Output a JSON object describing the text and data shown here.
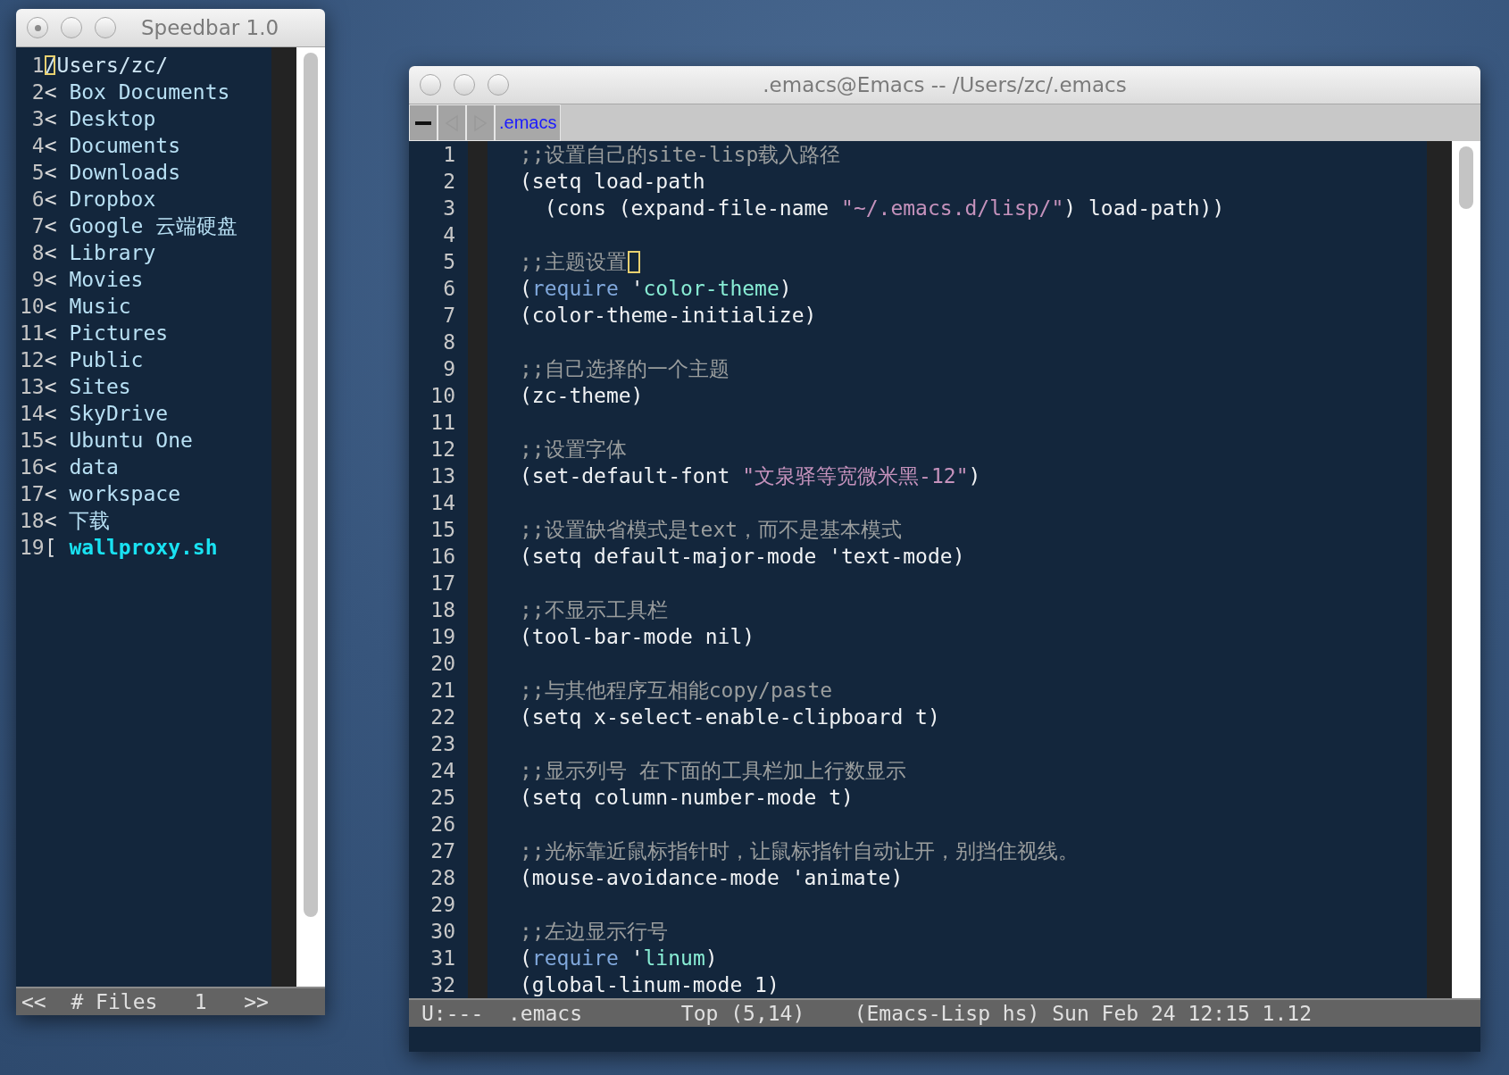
{
  "speedbar": {
    "window": {
      "title": "Speedbar 1.0"
    },
    "items": [
      {
        "number": "1",
        "marker": "",
        "name": "/Users/zc/",
        "kind": "root",
        "cursor": true
      },
      {
        "number": "2",
        "marker": "<",
        "name": "Box Documents",
        "kind": "directory",
        "cursor": false
      },
      {
        "number": "3",
        "marker": "<",
        "name": "Desktop",
        "kind": "directory",
        "cursor": false
      },
      {
        "number": "4",
        "marker": "<",
        "name": "Documents",
        "kind": "directory",
        "cursor": false
      },
      {
        "number": "5",
        "marker": "<",
        "name": "Downloads",
        "kind": "directory",
        "cursor": false
      },
      {
        "number": "6",
        "marker": "<",
        "name": "Dropbox",
        "kind": "directory",
        "cursor": false
      },
      {
        "number": "7",
        "marker": "<",
        "name": "Google 云端硬盘",
        "kind": "directory",
        "cursor": false
      },
      {
        "number": "8",
        "marker": "<",
        "name": "Library",
        "kind": "directory",
        "cursor": false
      },
      {
        "number": "9",
        "marker": "<",
        "name": "Movies",
        "kind": "directory",
        "cursor": false
      },
      {
        "number": "10",
        "marker": "<",
        "name": "Music",
        "kind": "directory",
        "cursor": false
      },
      {
        "number": "11",
        "marker": "<",
        "name": "Pictures",
        "kind": "directory",
        "cursor": false
      },
      {
        "number": "12",
        "marker": "<",
        "name": "Public",
        "kind": "directory",
        "cursor": false
      },
      {
        "number": "13",
        "marker": "<",
        "name": "Sites",
        "kind": "directory",
        "cursor": false
      },
      {
        "number": "14",
        "marker": "<",
        "name": "SkyDrive",
        "kind": "directory",
        "cursor": false
      },
      {
        "number": "15",
        "marker": "<",
        "name": "Ubuntu One",
        "kind": "directory",
        "cursor": false
      },
      {
        "number": "16",
        "marker": "<",
        "name": "data",
        "kind": "directory",
        "cursor": false
      },
      {
        "number": "17",
        "marker": "<",
        "name": "workspace",
        "kind": "directory",
        "cursor": false
      },
      {
        "number": "18",
        "marker": "<",
        "name": "下载",
        "kind": "directory",
        "cursor": false
      },
      {
        "number": "19",
        "marker": "[",
        "name": "wallproxy.sh",
        "kind": "file",
        "cursor": false
      }
    ],
    "mode_line": {
      "prev": "<<",
      "label": "# Files",
      "page": "1",
      "next": ">>"
    }
  },
  "editor": {
    "window": {
      "title": ".emacs@Emacs -- /Users/zc/.emacs"
    },
    "tabs": [
      {
        "label": ".emacs",
        "selected": true
      }
    ],
    "lines": [
      {
        "number": "1",
        "cursor": false,
        "segments": [
          {
            "kind": "comment",
            "text": ";;设置自己的site-lisp载入路径"
          }
        ]
      },
      {
        "number": "2",
        "cursor": false,
        "segments": [
          {
            "kind": "plain",
            "text": "(setq load-path"
          }
        ]
      },
      {
        "number": "3",
        "cursor": false,
        "segments": [
          {
            "kind": "plain",
            "text": "  (cons (expand-file-name "
          },
          {
            "kind": "string",
            "text": "\"~/.emacs.d/lisp/\""
          },
          {
            "kind": "plain",
            "text": ") load-path))"
          }
        ]
      },
      {
        "number": "4",
        "cursor": false
      },
      {
        "number": "5",
        "cursor": true,
        "segments": [
          {
            "kind": "comment",
            "text": ";;主题设置"
          }
        ]
      },
      {
        "number": "6",
        "cursor": false,
        "segments": [
          {
            "kind": "plain",
            "text": "("
          },
          {
            "kind": "keyword",
            "text": "require"
          },
          {
            "kind": "plain",
            "text": " '"
          },
          {
            "kind": "constant",
            "text": "color-theme"
          },
          {
            "kind": "plain",
            "text": ")"
          }
        ]
      },
      {
        "number": "7",
        "cursor": false,
        "segments": [
          {
            "kind": "plain",
            "text": "(color-theme-initialize)"
          }
        ]
      },
      {
        "number": "8",
        "cursor": false
      },
      {
        "number": "9",
        "cursor": false,
        "segments": [
          {
            "kind": "comment",
            "text": ";;自己选择的一个主题"
          }
        ]
      },
      {
        "number": "10",
        "cursor": false,
        "segments": [
          {
            "kind": "plain",
            "text": "(zc-theme)"
          }
        ]
      },
      {
        "number": "11",
        "cursor": false
      },
      {
        "number": "12",
        "cursor": false,
        "segments": [
          {
            "kind": "comment",
            "text": ";;设置字体"
          }
        ]
      },
      {
        "number": "13",
        "cursor": false,
        "segments": [
          {
            "kind": "plain",
            "text": "(set-default-font "
          },
          {
            "kind": "string",
            "text": "\"文泉驿等宽微米黑-12\""
          },
          {
            "kind": "plain",
            "text": ")"
          }
        ]
      },
      {
        "number": "14",
        "cursor": false
      },
      {
        "number": "15",
        "cursor": false,
        "segments": [
          {
            "kind": "comment",
            "text": ";;设置缺省模式是text，而不是基本模式"
          }
        ]
      },
      {
        "number": "16",
        "cursor": false,
        "segments": [
          {
            "kind": "plain",
            "text": "(setq default-major-mode 'text-mode)"
          }
        ]
      },
      {
        "number": "17",
        "cursor": false
      },
      {
        "number": "18",
        "cursor": false,
        "segments": [
          {
            "kind": "comment",
            "text": ";;不显示工具栏"
          }
        ]
      },
      {
        "number": "19",
        "cursor": false,
        "segments": [
          {
            "kind": "plain",
            "text": "(tool-bar-mode nil)"
          }
        ]
      },
      {
        "number": "20",
        "cursor": false
      },
      {
        "number": "21",
        "cursor": false,
        "segments": [
          {
            "kind": "comment",
            "text": ";;与其他程序互相能copy/paste"
          }
        ]
      },
      {
        "number": "22",
        "cursor": false,
        "segments": [
          {
            "kind": "plain",
            "text": "(setq x-select-enable-clipboard t)"
          }
        ]
      },
      {
        "number": "23",
        "cursor": false
      },
      {
        "number": "24",
        "cursor": false,
        "segments": [
          {
            "kind": "comment",
            "text": ";;显示列号 在下面的工具栏加上行数显示"
          }
        ]
      },
      {
        "number": "25",
        "cursor": false,
        "segments": [
          {
            "kind": "plain",
            "text": "(setq column-number-mode t)"
          }
        ]
      },
      {
        "number": "26",
        "cursor": false
      },
      {
        "number": "27",
        "cursor": false,
        "segments": [
          {
            "kind": "comment",
            "text": ";;光标靠近鼠标指针时，让鼠标指针自动让开，别挡住视线。"
          }
        ]
      },
      {
        "number": "28",
        "cursor": false,
        "segments": [
          {
            "kind": "plain",
            "text": "(mouse-avoidance-mode 'animate)"
          }
        ]
      },
      {
        "number": "29",
        "cursor": false
      },
      {
        "number": "30",
        "cursor": false,
        "segments": [
          {
            "kind": "comment",
            "text": ";;左边显示行号"
          }
        ]
      },
      {
        "number": "31",
        "cursor": false,
        "segments": [
          {
            "kind": "plain",
            "text": "("
          },
          {
            "kind": "keyword",
            "text": "require"
          },
          {
            "kind": "plain",
            "text": " '"
          },
          {
            "kind": "constant",
            "text": "linum"
          },
          {
            "kind": "plain",
            "text": ")"
          }
        ]
      },
      {
        "number": "32",
        "cursor": false,
        "segments": [
          {
            "kind": "plain",
            "text": "(global-linum-mode 1)"
          }
        ]
      }
    ],
    "mode_line": {
      "status": "U:---",
      "buffer": ".emacs",
      "position": "Top (5,14)",
      "modes": "(Emacs-Lisp hs) Sun Feb 24 12:15 1.12"
    }
  }
}
